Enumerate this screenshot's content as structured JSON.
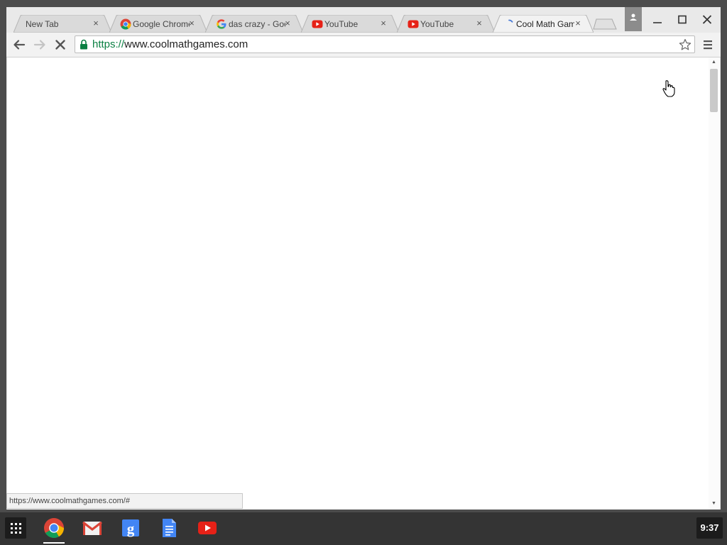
{
  "tabs": [
    {
      "title": "New Tab",
      "favicon": "none",
      "active": false
    },
    {
      "title": "Google Chrome",
      "favicon": "chrome-icon",
      "active": false
    },
    {
      "title": "das crazy - Google",
      "favicon": "google-icon",
      "active": false
    },
    {
      "title": "YouTube",
      "favicon": "youtube-icon",
      "active": false
    },
    {
      "title": "YouTube",
      "favicon": "youtube-icon",
      "active": false
    },
    {
      "title": "Cool Math Games",
      "favicon": "loading-spinner-icon",
      "active": true
    }
  ],
  "tab_close_glyph": "×",
  "omnibox": {
    "scheme": "https://",
    "host": "www.coolmathgames.com",
    "secure": true
  },
  "toolbar": {
    "back": "back-arrow-icon",
    "forward": "forward-arrow-icon",
    "stop": "stop-x-icon",
    "bookmark": "star-icon",
    "menu": "hamburger-menu-icon"
  },
  "status_bar": {
    "text": "https://www.coolmathgames.com/#"
  },
  "shelf": {
    "apps": [
      "chrome-icon",
      "gmail-icon",
      "google-search-icon",
      "google-docs-icon",
      "youtube-icon"
    ],
    "clock": "9:37"
  },
  "colors": {
    "secure_scheme": "#0b8043",
    "youtube_red": "#e62117",
    "shelf_bg": "#343434"
  }
}
